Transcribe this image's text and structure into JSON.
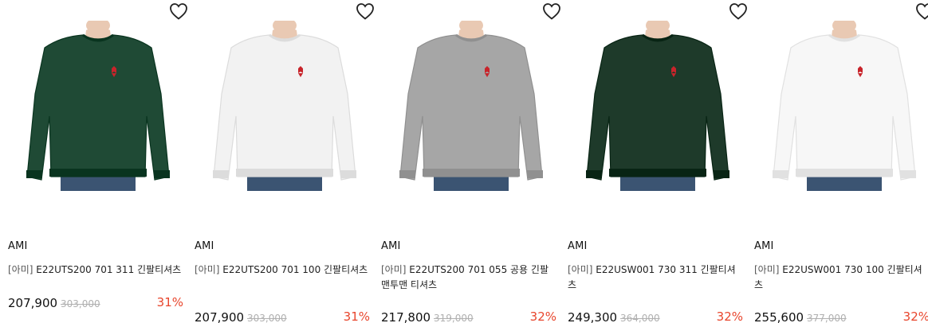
{
  "colors": {
    "discount": "#e8452c",
    "strike": "#b0b0b0",
    "logo": "#c8242b"
  },
  "products": [
    {
      "brand": "AMI",
      "name_prefix": "[아미]",
      "name": "E22UTS200 701 311 긴팔티셔츠",
      "price": "207,900",
      "original_price": "303,000",
      "discount": "31%",
      "shirt_color": "#1f4a35",
      "icon": "heart-outline-icon"
    },
    {
      "brand": "AMI",
      "name_prefix": "[아미]",
      "name": "E22UTS200 701 100 긴팔티셔츠",
      "price": "207,900",
      "original_price": "303,000",
      "discount": "31%",
      "shirt_color": "#f2f2f2",
      "icon": "heart-outline-icon"
    },
    {
      "brand": "AMI",
      "name_prefix": "[아미]",
      "name": "E22UTS200 701 055 공용 긴팔맨투맨 티셔츠",
      "price": "217,800",
      "original_price": "319,000",
      "discount": "32%",
      "shirt_color": "#a6a6a6",
      "icon": "heart-outline-icon"
    },
    {
      "brand": "AMI",
      "name_prefix": "[아미]",
      "name": "E22USW001 730 311 긴팔티셔츠",
      "price": "249,300",
      "original_price": "364,000",
      "discount": "32%",
      "shirt_color": "#1e3a2a",
      "icon": "heart-outline-icon"
    },
    {
      "brand": "AMI",
      "name_prefix": "[아미]",
      "name": "E22USW001 730 100 긴팔티셔츠",
      "price": "255,600",
      "original_price": "377,000",
      "discount": "32%",
      "shirt_color": "#f7f7f7",
      "icon": "heart-outline-icon"
    }
  ]
}
